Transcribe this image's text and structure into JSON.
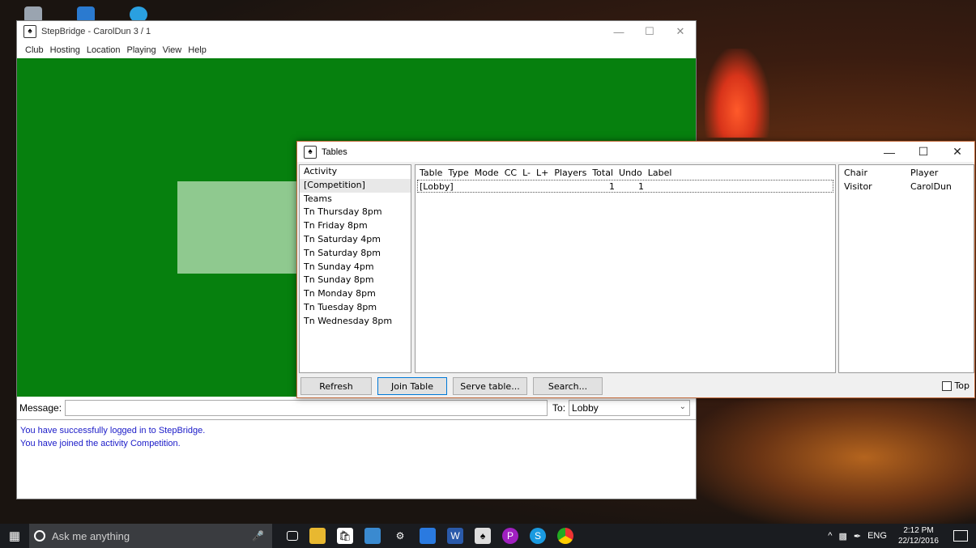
{
  "main_window": {
    "title": "StepBridge - CarolDun 3 / 1",
    "controls": {
      "minimize": "—",
      "maximize": "☐",
      "close": "✕"
    },
    "menu": [
      "Club",
      "Hosting",
      "Location",
      "Playing",
      "View",
      "Help"
    ],
    "message_label": "Message:",
    "message_value": "",
    "to_label": "To:",
    "to_value": "Lobby",
    "chat": [
      "You have successfully logged in to StepBridge.",
      "You have joined the activity Competition."
    ]
  },
  "tables_window": {
    "title": "Tables",
    "controls": {
      "minimize": "—",
      "maximize": "☐",
      "close": "✕"
    },
    "activity_header": "Activity",
    "activities": [
      "[Competition]",
      "Teams",
      "Tn Thursday 8pm",
      "Tn Friday 8pm",
      "Tn Saturday 4pm",
      "Tn Saturday 8pm",
      "Tn Sunday 4pm",
      "Tn Sunday 8pm",
      "Tn Monday 8pm",
      "Tn Tuesday 8pm",
      "Tn Wednesday 8pm"
    ],
    "selected_activity": 0,
    "table_columns": [
      "Table",
      "Type",
      "Mode",
      "CC",
      "L-",
      "L+",
      "Players",
      "Total",
      "Undo",
      "Label"
    ],
    "table_rows": [
      {
        "table": "[Lobby]",
        "players": "1",
        "total": "1"
      }
    ],
    "chair_columns": [
      "Chair",
      "Player"
    ],
    "chair_rows": [
      {
        "chair": "Visitor",
        "player": "CarolDun"
      }
    ],
    "buttons": {
      "refresh": "Refresh",
      "join": "Join Table",
      "serve": "Serve table...",
      "search": "Search..."
    },
    "top_label": "Top",
    "top_checked": false
  },
  "taskbar": {
    "search_placeholder": "Ask me anything",
    "language": "ENG",
    "time": "2:12 PM",
    "date": "22/12/2016",
    "icons": [
      "windows-icon",
      "microphone-icon",
      "task-view-icon",
      "file-explorer-icon",
      "store-icon",
      "photos-icon",
      "settings-icon",
      "docs-icon",
      "word-icon",
      "stepbridge-icon",
      "p-app-icon",
      "skype-icon",
      "chrome-icon"
    ]
  },
  "colors": {
    "felt_green": "#06800e",
    "panel_green": "#8fc98f",
    "chat_blue": "#1a1ac8",
    "focus_blue": "#0078d7"
  }
}
